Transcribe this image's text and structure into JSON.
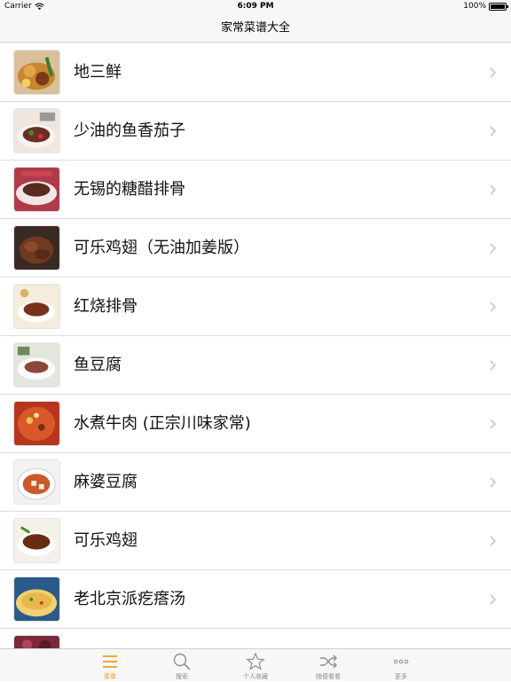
{
  "status_bar": {
    "carrier": "Carrier",
    "time": "6:09 PM",
    "battery": "100%"
  },
  "nav": {
    "title": "家常菜谱大全"
  },
  "recipes": [
    {
      "title": "地三鲜"
    },
    {
      "title": "少油的鱼香茄子"
    },
    {
      "title": "无锡的糖醋排骨"
    },
    {
      "title": "可乐鸡翅（无油加姜版）"
    },
    {
      "title": "红烧排骨"
    },
    {
      "title": "鱼豆腐"
    },
    {
      "title": "水煮牛肉 (正宗川味家常)"
    },
    {
      "title": "麻婆豆腐"
    },
    {
      "title": "可乐鸡翅"
    },
    {
      "title": "老北京派疙瘩汤"
    },
    {
      "title": ""
    }
  ],
  "tabs": [
    {
      "label": "菜单",
      "icon": "menu-icon",
      "active": true
    },
    {
      "label": "搜索",
      "icon": "search-icon",
      "active": false
    },
    {
      "label": "个人收藏",
      "icon": "star-icon",
      "active": false
    },
    {
      "label": "随便看看",
      "icon": "shuffle-icon",
      "active": false
    },
    {
      "label": "更多",
      "icon": "more-icon",
      "active": false
    }
  ],
  "colors": {
    "accent": "#f29b1d",
    "inactive": "#8e8e93"
  }
}
